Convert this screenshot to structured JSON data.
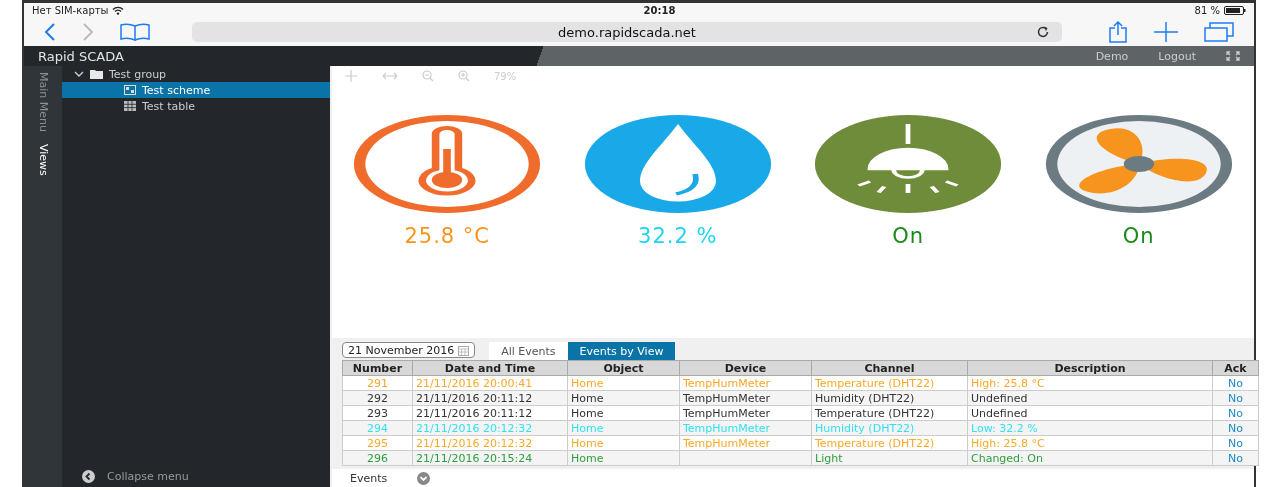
{
  "status_bar": {
    "carrier": "Нет SIM-карты",
    "time": "20:18",
    "battery": "81 %"
  },
  "browser": {
    "url": "demo.rapidscada.net"
  },
  "header": {
    "title": "Rapid SCADA",
    "user": "Demo",
    "logout": "Logout"
  },
  "side_tabs": [
    {
      "label": "Main Menu",
      "selected": false
    },
    {
      "label": "Views",
      "selected": true
    }
  ],
  "tree": [
    {
      "label": "Test group",
      "expanded": true,
      "children": [
        {
          "label": "Test scheme",
          "kind": "scheme",
          "selected": true
        },
        {
          "label": "Test table",
          "kind": "table",
          "selected": false
        }
      ]
    }
  ],
  "collapse_menu": "Collapse menu",
  "scheme_toolbar": {
    "zoom": "79%"
  },
  "gauges": [
    {
      "kind": "thermometer",
      "value": "25.8 °C",
      "color": "#f7941d"
    },
    {
      "kind": "drop",
      "value": "32.2 %",
      "color": "#1cd6f0"
    },
    {
      "kind": "lamp",
      "value": "On",
      "color": "#1a8a1a"
    },
    {
      "kind": "fan",
      "value": "On",
      "color": "#1a8a1a"
    }
  ],
  "events": {
    "date": "21 November 2016",
    "tabs": [
      {
        "label": "All Events",
        "selected": false
      },
      {
        "label": "Events by View",
        "selected": true
      }
    ],
    "columns": [
      "Number",
      "Date and Time",
      "Object",
      "Device",
      "Channel",
      "Description",
      "Ack"
    ],
    "rows": [
      {
        "color": "#f9a825",
        "cells": [
          "291",
          "21/11/2016 20:00:41",
          "Home",
          "TempHumMeter",
          "Temperature (DHT22)",
          "High: 25.8 °C",
          "No"
        ]
      },
      {
        "color": "#333333",
        "cells": [
          "292",
          "21/11/2016 20:11:12",
          "Home",
          "TempHumMeter",
          "Humidity (DHT22)",
          "Undefined",
          "No"
        ]
      },
      {
        "color": "#333333",
        "cells": [
          "293",
          "21/11/2016 20:11:12",
          "Home",
          "TempHumMeter",
          "Temperature (DHT22)",
          "Undefined",
          "No"
        ]
      },
      {
        "color": "#33e0f0",
        "cells": [
          "294",
          "21/11/2016 20:12:32",
          "Home",
          "TempHumMeter",
          "Humidity (DHT22)",
          "Low: 32.2 %",
          "No"
        ]
      },
      {
        "color": "#f9a825",
        "cells": [
          "295",
          "21/11/2016 20:12:32",
          "Home",
          "TempHumMeter",
          "Temperature (DHT22)",
          "High: 25.8 °C",
          "No"
        ]
      },
      {
        "color": "#2e9e3e",
        "cells": [
          "296",
          "21/11/2016 20:15:24",
          "Home",
          "",
          "Light",
          "Changed: On",
          "No"
        ]
      }
    ]
  },
  "footer": {
    "label": "Events"
  }
}
